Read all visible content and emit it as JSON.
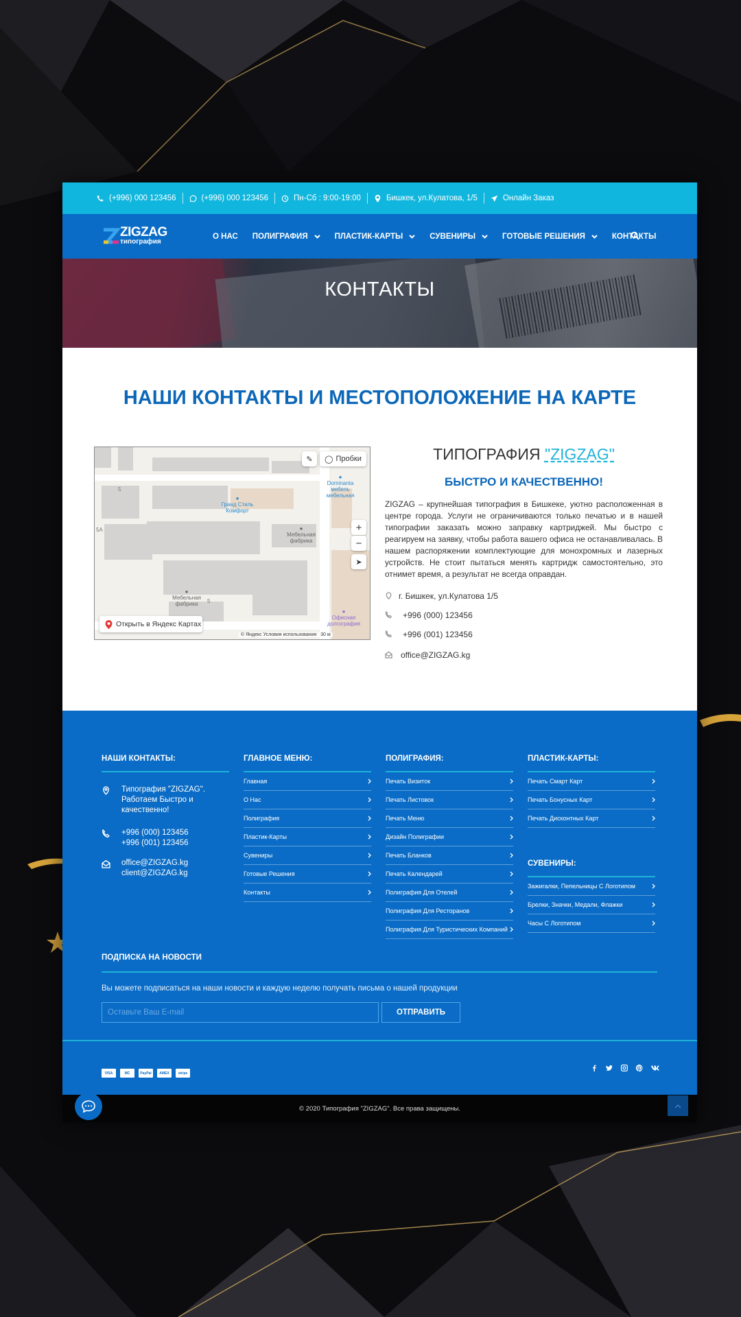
{
  "topbar": {
    "phone": "(+996) 000 123456",
    "whatsapp": "(+996) 000 123456",
    "hours": "Пн-Сб : 9:00-19:00",
    "address": "Бишкек, ул.Кулатова, 1/5",
    "order": "Онлайн Заказ"
  },
  "logo": {
    "title": "ZIGZAG",
    "subtitle": "типография"
  },
  "nav": {
    "items": [
      "О НАС",
      "ПОЛИГРАФИЯ",
      "ПЛАСТИК-КАРТЫ",
      "СУВЕНИРЫ",
      "ГОТОВЫЕ РЕШЕНИЯ",
      "КОНТАКТЫ"
    ],
    "search_icon": "search-icon"
  },
  "hero": {
    "title": "КОНТАКТЫ"
  },
  "contacts": {
    "heading": "НАШИ КОНТАКТЫ И МЕСТОПОЛОЖЕНИЕ НА КАРТЕ",
    "company_prefix": "ТИПОГРАФИЯ ",
    "company_name": "\"ZIGZAG\"",
    "slogan": "БЫСТРО И КАЧЕСТВЕННО!",
    "description": "ZIGZAG – крупнейшая типография в Бишкеке, уютно расположенная в центре города. Услуги не ограничиваются только печатью и в нашей типографии заказать можно заправку картриджей. Мы быстро с реагируем на заявку, чтобы работа вашего офиса не останавливалась. В нашем распоряжении комплектующие для монохромных и лазерных устройств. Не стоит пытаться менять картридж самостоятельно, это отнимет время, а результат не всегда оправдан.",
    "address": "г. Бишкек, ул.Кулатова 1/5",
    "phone1": "+996 (000) 123456",
    "phone2": "+996 (001) 123456",
    "email": "office@ZIGZAG.kg"
  },
  "map": {
    "traffic": "Пробки",
    "open_link": "Открыть в Яндекс Картах",
    "copyright": "© Яндекс   Условия использования",
    "scale": "30 м",
    "zoom_in": "+",
    "zoom_out": "−",
    "labels": {
      "grand": "Гранд Стиль\nКомфорт",
      "dominanta": "Dominanta\nмебель\nмебельная",
      "fabrika1": "Мебельная\nфабрика",
      "fabrika2": "Мебельная\nфабрика",
      "office": "Офисная\nдолгография",
      "n5a": "5",
      "n5b": "5А",
      "n5c": "5"
    }
  },
  "footer": {
    "contacts_title": "НАШИ КОНТАКТЫ:",
    "contact_name": "Типография \"ZIGZAG\". Работаем Быстро и качественно!",
    "contact_phone1": "+996 (000) 123456",
    "contact_phone2": "+996 (001) 123456",
    "contact_email1": "office@ZIGZAG.kg",
    "contact_email2": "client@ZIGZAG.kg",
    "main_menu_title": "ГЛАВНОЕ МЕНЮ:",
    "main_menu": [
      "Главная",
      "О Нас",
      "Полиграфия",
      "Пластик-Карты",
      "Сувениры",
      "Готовые Решения",
      "Контакты"
    ],
    "poligraphy_title": "ПОЛИГРАФИЯ:",
    "poligraphy": [
      "Печать Визиток",
      "Печать Листовок",
      "Печать Меню",
      "Дизайн Полиграфии",
      "Печать Бланков",
      "Печать Календарей",
      "Полиграфия Для Отелей",
      "Полиграфия Для Ресторанов",
      "Полиграфия Для Туристических Компаний"
    ],
    "cards_title": "ПЛАСТИК-КАРТЫ:",
    "cards": [
      "Печать Смарт Карт",
      "Печать Бонусных Карт",
      "Печать Дисконтных Карт"
    ],
    "souvenirs_title": "СУВЕНИРЫ:",
    "souvenirs": [
      "Зажигалки, Пепельницы С Логотипом",
      "Брелки, Значки, Медали, Флажки",
      "Часы С Логотипом"
    ],
    "subscribe_title": "ПОДПИСКА НА НОВОСТИ",
    "subscribe_text": "Вы можете подписаться на наши новости и каждую неделю получать письма о нашей продукции",
    "email_placeholder": "Оставьте Ваш E-mail",
    "submit": "ОТПРАВИТЬ",
    "payments": [
      "VISA",
      "MC",
      "PayPal",
      "AMEX",
      "stripe"
    ],
    "copyright": "© 2020 Типография \"ZIGZAG\". Все права защищены."
  },
  "colors": {
    "primary": "#0a6cc6",
    "accent": "#10b6dd",
    "heading": "#0c67b8"
  }
}
